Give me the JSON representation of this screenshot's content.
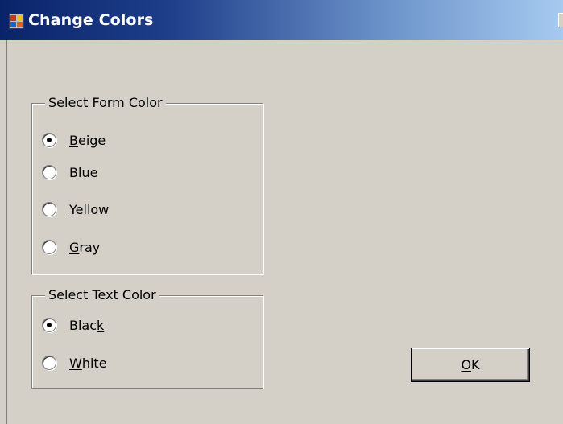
{
  "window": {
    "title": "Change Colors",
    "icon": "app-window-icon",
    "colors": {
      "title_start": "#0a246a",
      "title_end": "#a6caf0",
      "face": "#d4d0c8"
    }
  },
  "form_color_group": {
    "legend": "Select  Form Color",
    "selected": "Beige",
    "options": [
      {
        "pre": "",
        "key": "B",
        "post": "eige",
        "checked": true
      },
      {
        "pre": "B",
        "key": "l",
        "post": "ue",
        "checked": false
      },
      {
        "pre": "",
        "key": "Y",
        "post": "ellow",
        "checked": false
      },
      {
        "pre": "",
        "key": "G",
        "post": "ray",
        "checked": false
      }
    ]
  },
  "text_color_group": {
    "legend": "Select Text Color",
    "selected": "Black",
    "options": [
      {
        "pre": "Blac",
        "key": "k",
        "post": "",
        "checked": true
      },
      {
        "pre": "",
        "key": "W",
        "post": "hite",
        "checked": false
      }
    ]
  },
  "ok_button": {
    "key": "O",
    "post": "K"
  }
}
